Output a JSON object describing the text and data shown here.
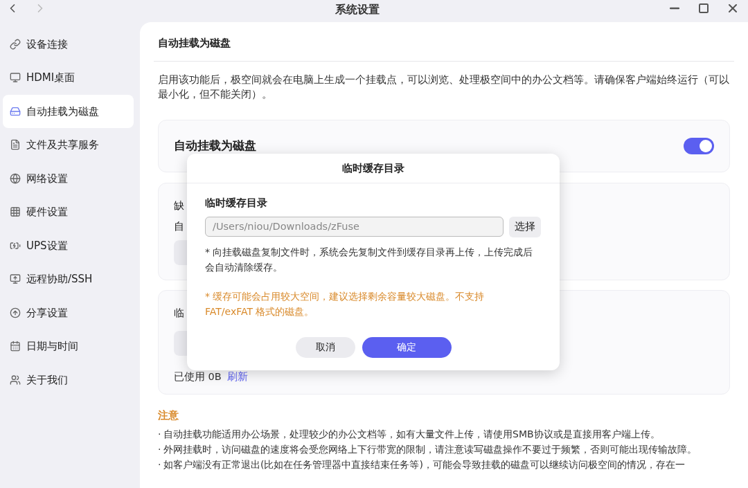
{
  "window": {
    "title": "系统设置"
  },
  "sidebar": {
    "items": [
      {
        "label": "设备连接",
        "selected": false
      },
      {
        "label": "HDMI桌面",
        "selected": false
      },
      {
        "label": "自动挂载为磁盘",
        "selected": true
      },
      {
        "label": "文件及共享服务",
        "selected": false
      },
      {
        "label": "网络设置",
        "selected": false
      },
      {
        "label": "硬件设置",
        "selected": false
      },
      {
        "label": "UPS设置",
        "selected": false
      },
      {
        "label": "远程协助/SSH",
        "selected": false
      },
      {
        "label": "分享设置",
        "selected": false
      },
      {
        "label": "日期与时间",
        "selected": false
      },
      {
        "label": "关于我们",
        "selected": false
      }
    ]
  },
  "main": {
    "title": "自动挂载为磁盘",
    "description": "启用该功能后，极空间就会在电脑上生成一个挂载点，可以浏览、处理极空间中的办公文档等。请确保客户端始终运行（可以最小化，但不能关闭）。",
    "toggle_card": {
      "label": "自动挂载为磁盘",
      "on": true
    },
    "card_2": {
      "line_1": "缺",
      "line_2": "自"
    },
    "card_3": {
      "line_1": "临",
      "usage": "已使用 0B",
      "refresh_link": "刷新"
    },
    "notes": {
      "title": "注意",
      "bullet": "·",
      "items": [
        "自动挂载功能适用办公场景，处理较少的办公文档等，如有大量文件上传，请使用SMB协议或是直接用客户端上传。",
        "外网挂载时，访问磁盘的速度将会受您网络上下行带宽的限制，请注意读写磁盘操作不要过于频繁，否则可能出现传输故障。",
        "如客户端没有正常退出(比如在任务管理器中直接结束任务等)，可能会导致挂载的磁盘可以继续访问极空间的情况，存在一"
      ]
    }
  },
  "dialog": {
    "title": "临时缓存目录",
    "field_label": "临时缓存目录",
    "path_value": "/Users/niou/Downloads/zFuse",
    "choose_button": "选择",
    "hint": "* 向挂载磁盘复制文件时，系统会先复制文件到缓存目录再上传，上传完成后会自动清除缓存。",
    "warning": "* 缓存可能会占用较大空间，建议选择剩余容量较大磁盘。不支持 FAT/exFAT 格式的磁盘。",
    "cancel_button": "取消",
    "confirm_button": "确定"
  }
}
